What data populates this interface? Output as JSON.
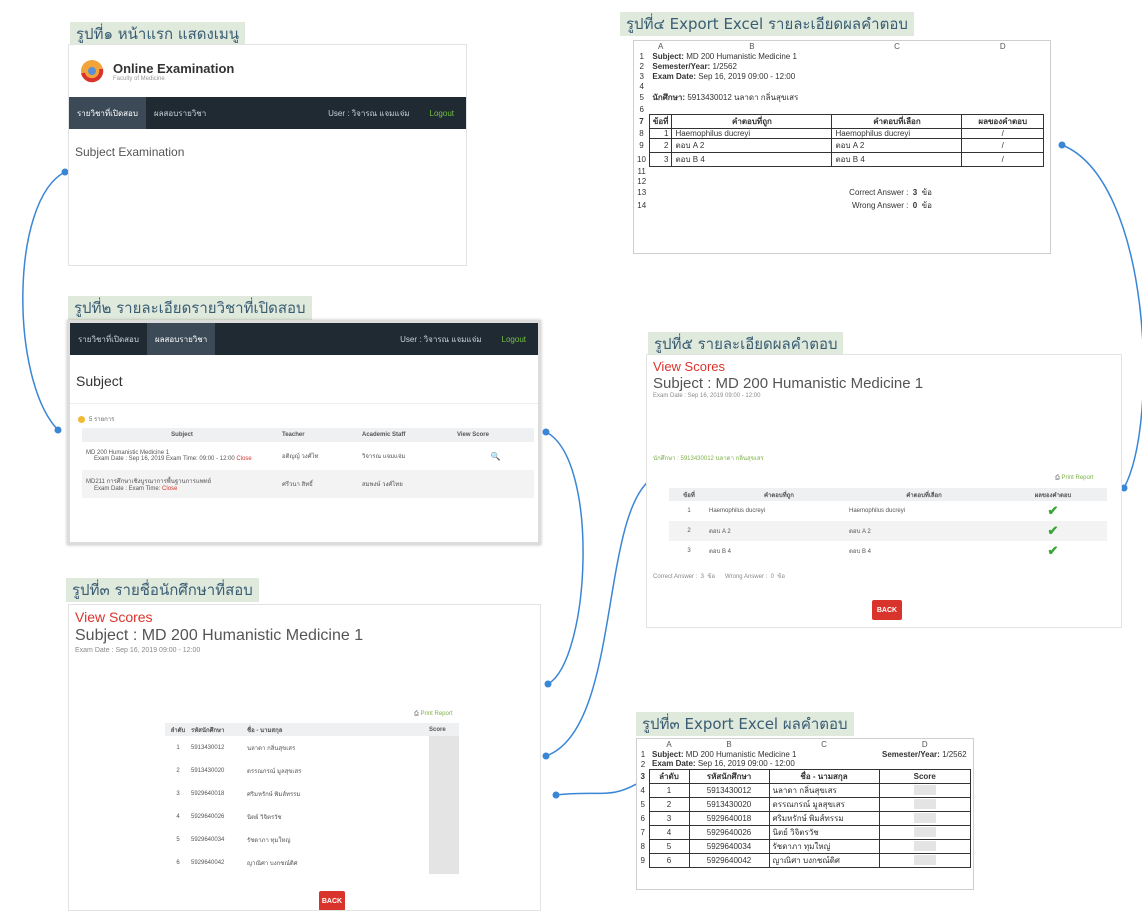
{
  "captions": {
    "c1": "รูปที่๑ หน้าแรก แสดงเมนู",
    "c2": "รูปที่๒ รายละเอียดรายวิชาที่เปิดสอบ",
    "c3": "รูปที่๓ รายชื่อนักศึกษาที่สอบ",
    "c4": "รูปที่๔ Export Excel รายละเอียดผลคำตอบ",
    "c5": "รูปที่๕ รายละเอียดผลคำตอบ",
    "c6": "รูปที่๓ Export Excel ผลคำตอบ"
  },
  "nav": {
    "item1": "รายวิชาที่เปิดสอบ",
    "item2": "ผลสอบรายวิชา",
    "user": "User : วิจารณ แจมแจ่ม",
    "logout": "Logout"
  },
  "home": {
    "app_title": "Online Examination",
    "app_subtitle": "Faculty of Medicine",
    "heading": "Subject Examination"
  },
  "subject": {
    "heading": "Subject",
    "status": "5 รายการ",
    "columns": [
      "Subject",
      "Teacher",
      "Academic Staff",
      "View Score"
    ],
    "rows": [
      {
        "title": "MD 200 Humanistic Medicine 1",
        "detail": "Exam Date : Sep 16, 2019  Exam Time: 09:00 - 12:00",
        "status": "Close",
        "teacher": "อติญญ์ วงศ์ไท",
        "staff": "วิจารณ แจมแจ่ม"
      },
      {
        "title": "MD211 การศึกษาเชิงบูรณาการพื้นฐานการแพทย์",
        "detail": "Exam Date :    Exam Time:",
        "status": "Close",
        "teacher": "ศรีวนา สิทธิ์",
        "staff": "สมพงษ์ วงศ์ไทย"
      }
    ]
  },
  "students": {
    "view_scores": "View Scores",
    "subject": "Subject : MD 200 Humanistic Medicine 1",
    "exam_date": "Exam Date : Sep 16, 2019   09:00 - 12:00",
    "print": "Print Report",
    "columns": [
      "ลำดับ",
      "รหัสนักศึกษา",
      "ชื่อ - นามสกุล",
      "Score"
    ],
    "rows": [
      {
        "no": "1",
        "id": "5913430012",
        "name": "นลาดา กลิ่นสุขเสร"
      },
      {
        "no": "2",
        "id": "5913430020",
        "name": "ดรรณกรณ์ มูลสุขเสร"
      },
      {
        "no": "3",
        "id": "5929640018",
        "name": "ศริมหรักษ์ พิมส์ทรรม"
      },
      {
        "no": "4",
        "id": "5929640026",
        "name": "นิตย์ วิจิตรวัช"
      },
      {
        "no": "5",
        "id": "5929640034",
        "name": "รัชดาภา ทุมใหญ่"
      },
      {
        "no": "6",
        "id": "5929640042",
        "name": "ญาณิศา บงกชณ์ดิศ"
      }
    ],
    "back": "BACK"
  },
  "excel_detail": {
    "cols": [
      "A",
      "B",
      "C",
      "D"
    ],
    "subject_label": "Subject:",
    "subject_value": "MD 200 Humanistic Medicine 1",
    "semester_label": "Semester/Year:",
    "semester_value": "1/2562",
    "exam_label": "Exam Date:",
    "exam_value": "Sep 16, 2019   09:00 - 12:00",
    "student_label": "นักศึกษา:",
    "student_value": "5913430012   นลาดา   กลิ่นสุขเสร",
    "headers": [
      "ข้อที่",
      "คำตอบที่ถูก",
      "คำตอบที่เลือก",
      "ผลของคำตอบ"
    ],
    "rows": [
      {
        "no": "1",
        "correct": "Haemophilus ducreyi",
        "selected": "Haemophilus ducreyi",
        "result": "/"
      },
      {
        "no": "2",
        "correct": "ตอบ A 2",
        "selected": "ตอบ A 2",
        "result": "/"
      },
      {
        "no": "3",
        "correct": "ตอบ B 4",
        "selected": "ตอบ B 4",
        "result": "/"
      }
    ],
    "correct_label": "Correct Answer :",
    "correct_value": "3",
    "unit": "ข้อ",
    "wrong_label": "Wrong Answer :",
    "wrong_value": "0"
  },
  "answer_detail": {
    "view_scores": "View Scores",
    "subject": "Subject : MD 200 Humanistic Medicine 1",
    "exam_date": "Exam Date : Sep 16, 2019   09:00 - 12:00",
    "student": "นักศึกษา : 5913430012   นลาดา   กลิ่นสุขเสร",
    "print": "Print Report",
    "columns": [
      "ข้อที่",
      "คำตอบที่ถูก",
      "คำตอบที่เลือก",
      "ผลของคำตอบ"
    ],
    "rows": [
      {
        "no": "1",
        "correct": "Haemophilus ducreyi",
        "selected": "Haemophilus ducreyi"
      },
      {
        "no": "2",
        "correct": "ตอบ A 2",
        "selected": "ตอบ A 2"
      },
      {
        "no": "3",
        "correct": "ตอบ B 4",
        "selected": "ตอบ B 4"
      }
    ],
    "summary": "Correct Answer :  3  ข้อ      Wrong Answer :  0  ข้อ",
    "back": "BACK"
  },
  "excel_scores": {
    "cols": [
      "A",
      "B",
      "C",
      "D"
    ],
    "subject_label": "Subject:",
    "subject_value": "MD 200 Humanistic Medicine 1",
    "semester_label": "Semester/Year:",
    "semester_value": "1/2562",
    "exam_label": "Exam Date:",
    "exam_value": "Sep 16, 2019   09:00 - 12:00",
    "headers": [
      "ลำดับ",
      "รหัสนักศึกษา",
      "ชื่อ - นามสกุล",
      "Score"
    ],
    "rows": [
      {
        "no": "1",
        "id": "5913430012",
        "name": "นลาดา กลิ่นสุขเสร"
      },
      {
        "no": "2",
        "id": "5913430020",
        "name": "ดรรณกรณ์ มูลสุขเสร"
      },
      {
        "no": "3",
        "id": "5929640018",
        "name": "ศริมหรักษ์ พิมส์ทรรม"
      },
      {
        "no": "4",
        "id": "5929640026",
        "name": "นิตย์ วิจิตรวัช"
      },
      {
        "no": "5",
        "id": "5929640034",
        "name": "รัชดาภา ทุมใหญ่"
      },
      {
        "no": "6",
        "id": "5929640042",
        "name": "ญาณิศา บงกชณ์ดิศ"
      }
    ]
  },
  "colors": {
    "connector": "#3a86d6",
    "nav": "#1f2a33",
    "accent_red": "#d9342b",
    "check": "#3aa53a",
    "caption_bg": "#dfe9dc"
  }
}
